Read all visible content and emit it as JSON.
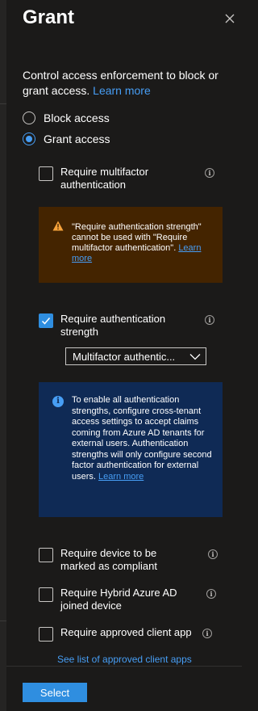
{
  "panel": {
    "title": "Grant",
    "close_icon": "close-icon"
  },
  "intro": {
    "text": "Control access enforcement to block or grant access.",
    "learn_more": "Learn more"
  },
  "access": {
    "options": [
      {
        "label": "Block access",
        "selected": false
      },
      {
        "label": "Grant access",
        "selected": true
      }
    ]
  },
  "controls": {
    "mfa": {
      "label": "Require multifactor authentication",
      "checked": false
    },
    "mfa_warning": {
      "text": "\"Require authentication strength\" cannot be used with \"Require multifactor authentication\".",
      "link": "Learn more"
    },
    "auth_strength": {
      "label": "Require authentication strength",
      "checked": true,
      "selected_value": "Multifactor authentic..."
    },
    "auth_strength_info": {
      "text": "To enable all authentication strengths, configure cross-tenant access settings to accept claims coming from Azure AD tenants for external users. Authentication strengths will only configure second factor authentication for external users.",
      "link": "Learn more"
    },
    "compliant": {
      "label": "Require device to be marked as compliant",
      "checked": false
    },
    "hybrid": {
      "label": "Require Hybrid Azure AD joined device",
      "checked": false
    },
    "approved_app": {
      "label": "Require approved client app",
      "checked": false
    },
    "approved_link": "See list of approved client apps"
  },
  "footer": {
    "select_label": "Select"
  },
  "colors": {
    "background": "#1b1a19",
    "accent": "#479ef5",
    "button": "#2f8ee0",
    "warning_bg": "#442400",
    "info_bg": "#0f2a55"
  }
}
